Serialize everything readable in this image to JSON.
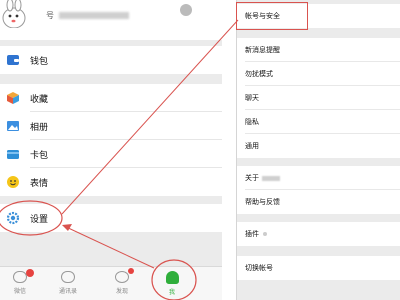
{
  "left_screen": {
    "profile": {
      "wechat_id_prefix": "号",
      "avatar_icon": "cartoon-bunny-avatar",
      "qr_icon": "qr-code-icon"
    },
    "menu": [
      {
        "id": "wallet",
        "label": "钱包",
        "icon": "wallet-icon",
        "color": "#2f74d0"
      },
      {
        "id": "favorites",
        "label": "收藏",
        "icon": "cube-icon",
        "color": "#f3a638"
      },
      {
        "id": "album",
        "label": "相册",
        "icon": "photo-icon",
        "color": "#3c8fe0"
      },
      {
        "id": "cards",
        "label": "卡包",
        "icon": "card-icon",
        "color": "#2e8fd6"
      },
      {
        "id": "stickers",
        "label": "表情",
        "icon": "smile-icon",
        "color": "#f5c518"
      },
      {
        "id": "settings",
        "label": "设置",
        "icon": "gear-icon",
        "color": "#3a8fd8"
      }
    ],
    "tabs": [
      {
        "id": "chats",
        "label": "微信",
        "icon": "chat-bubble-icon",
        "badge": true
      },
      {
        "id": "contacts",
        "label": "通讯录",
        "icon": "contacts-icon",
        "badge": false
      },
      {
        "id": "discover",
        "label": "发现",
        "icon": "compass-icon",
        "badge": true
      },
      {
        "id": "me",
        "label": "我",
        "icon": "person-icon",
        "badge": false,
        "active": true
      }
    ]
  },
  "right_screen": {
    "groups": [
      [
        "帐号与安全"
      ],
      [
        "新消息提醒",
        "勿扰模式",
        "聊天",
        "隐私",
        "通用"
      ],
      [
        "关于",
        "帮助与反馈"
      ],
      [
        "插件"
      ],
      [
        "切换帐号"
      ]
    ]
  },
  "colors": {
    "accent_green": "#2fae3b",
    "annotation_red": "#d9534f",
    "badge_red": "#e64340"
  }
}
